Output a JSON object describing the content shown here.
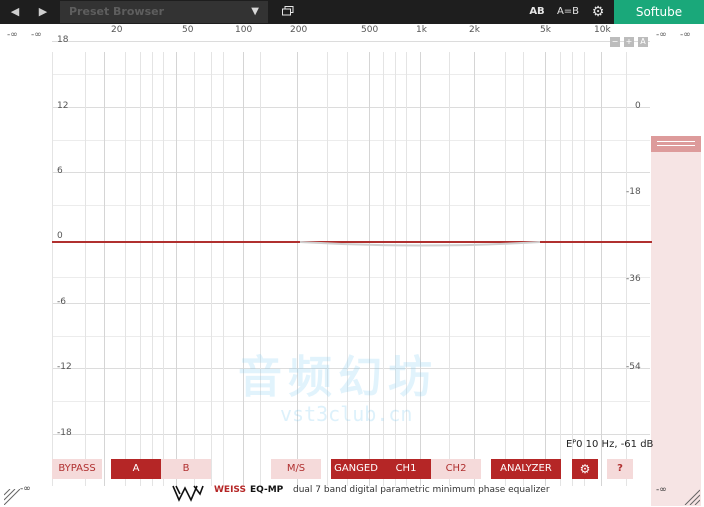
{
  "topbar": {
    "prev_icon": "◀",
    "next_icon": "▶",
    "preset_label": "Preset Browser",
    "dropdown_icon": "▼",
    "ab_icon_label": "AB",
    "ab_compare_label": "A=B",
    "settings_icon": "⚙",
    "brand_label": "Softube"
  },
  "graph": {
    "corner_left_top": "-∞",
    "corner_left_top2": "-∞",
    "corner_right_top": "-∞",
    "corner_right_top2": "-∞",
    "freq_labels": [
      "20",
      "50",
      "100",
      "200",
      "500",
      "1k",
      "2k",
      "5k",
      "10k"
    ],
    "gain_labels": [
      "18",
      "12",
      "6",
      "0",
      "-6",
      "-12",
      "-18"
    ],
    "meter_labels": [
      "0",
      "-18",
      "-36",
      "-54"
    ],
    "mini_buttons": [
      "−",
      "+",
      "A"
    ],
    "readout": "Eᴾ0 10 Hz, -61 dB"
  },
  "watermark": {
    "cn": "音频幻坊",
    "url": "vst3club.cn"
  },
  "buttons": {
    "bypass": "BYPASS",
    "a": "A",
    "b": "B",
    "ms": "M/S",
    "ganged": "GANGED",
    "ch1": "CH1",
    "ch2": "CH2",
    "analyzer": "ANALYZER",
    "gear": "⚙",
    "help": "?"
  },
  "footer": {
    "corner_left": "-∞",
    "corner_right": "-∞",
    "weiss": "WEISS",
    "product": "EQ-MP",
    "description": "dual 7 band digital parametric minimum phase equalizer"
  },
  "colors": {
    "accent": "#b52626",
    "brand": "#1aa87a"
  }
}
